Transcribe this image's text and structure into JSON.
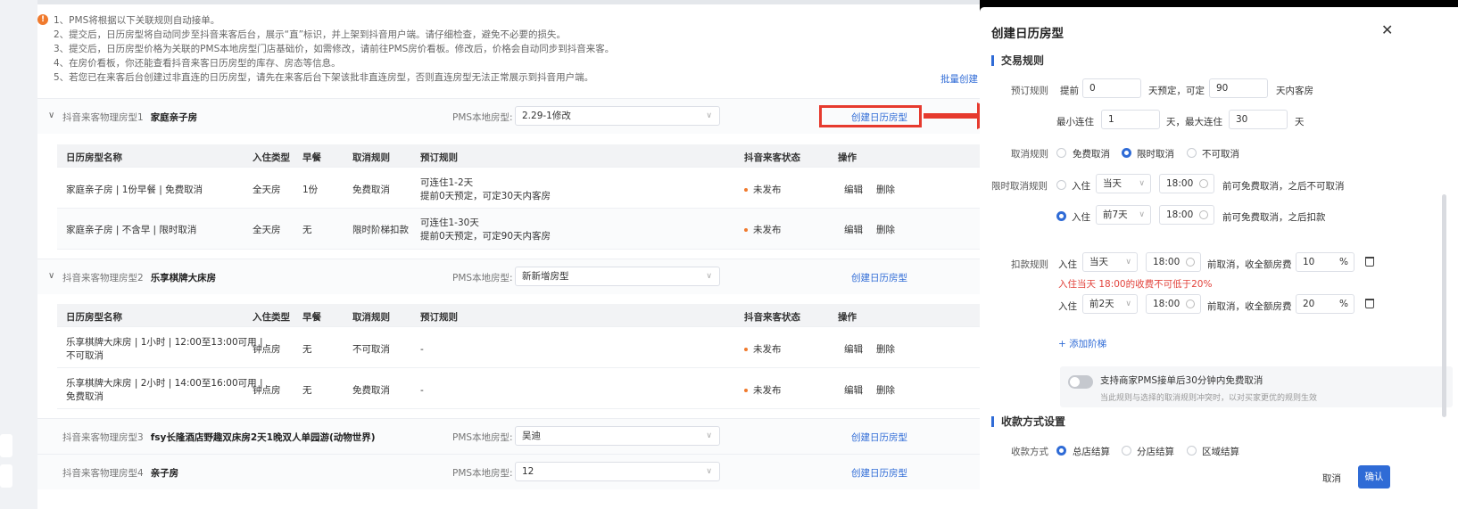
{
  "notices": [
    "1、PMS将根据以下关联规则自动接单。",
    "2、提交后，日历房型将自动同步至抖音来客后台，展示“直”标识，并上架到抖音用户端。请仔细检查，避免不必要的损失。",
    "3、提交后，日历房型价格为关联的PMS本地房型门店基础价，如需修改，请前往PMS房价看板。修改后，价格会自动同步到抖音来客。",
    "4、在房价看板，你还能查看抖音来客日历房型的库存、房态等信息。",
    "5、若您已在来客后台创建过非直连的日历房型，请先在来客后台下架该批非直连房型，否则直连房型无法正常展示到抖音用户端。"
  ],
  "batch_create": "批量创建",
  "pms_label": "PMS本地房型:",
  "create_label": "创建日历房型",
  "headers": [
    "日历房型名称",
    "入住类型",
    "早餐",
    "取消规则",
    "预订规则",
    "抖音来客状态",
    "操作"
  ],
  "edit_label": "编辑",
  "delete_label": "删除",
  "rooms": [
    {
      "label": "抖音来客物理房型1",
      "name": "家庭亲子房",
      "pms": "2.29-1修改",
      "rows": [
        {
          "name1": "家庭亲子房 | 1份早餐 | 免费取消",
          "name2": "",
          "type": "全天房",
          "breakfast": "1份",
          "cancel": "免费取消",
          "rule1": "可连住1-2天",
          "rule2": "提前0天预定，可定30天内客房",
          "status": "未发布"
        },
        {
          "name1": "家庭亲子房 | 不含早 | 限时取消",
          "name2": "",
          "type": "全天房",
          "breakfast": "无",
          "cancel": "限时阶梯扣款",
          "rule1": "可连住1-30天",
          "rule2": "提前0天预定，可定90天内客房",
          "status": "未发布"
        }
      ]
    },
    {
      "label": "抖音来客物理房型2",
      "name": "乐享棋牌大床房",
      "pms": "新新增房型",
      "rows": [
        {
          "name1": "乐享棋牌大床房 | 1小时 | 12:00至13:00可用 |",
          "name2": "不可取消",
          "type": "钟点房",
          "breakfast": "无",
          "cancel": "不可取消",
          "rule1": "-",
          "rule2": "",
          "status": "未发布"
        },
        {
          "name1": "乐享棋牌大床房 | 2小时 | 14:00至16:00可用 |",
          "name2": "免费取消",
          "type": "钟点房",
          "breakfast": "无",
          "cancel": "免费取消",
          "rule1": "-",
          "rule2": "",
          "status": "未发布"
        }
      ]
    },
    {
      "label": "抖音来客物理房型3",
      "name": "fsy长隆酒店野趣双床房2天1晚双人单园游(动物世界)",
      "pms": "吴迪"
    },
    {
      "label": "抖音来客物理房型4",
      "name": "亲子房",
      "pms": "12"
    }
  ],
  "modal": {
    "title": "创建日历房型",
    "section_trade": "交易规则",
    "booking_label": "预订规则",
    "advance_prefix": "提前",
    "advance_value": "0",
    "advance_mid": "天预定，可定",
    "advance_days": "90",
    "advance_suffix": "天内客房",
    "min_stay_prefix": "最小连住",
    "min_stay": "1",
    "max_stay_mid": "天，最大连住",
    "max_stay": "30",
    "day": "天",
    "cancel_label": "取消规则",
    "cancel_options": [
      "免费取消",
      "限时取消",
      "不可取消"
    ],
    "limited_label": "限时取消规则",
    "checkin": "入住",
    "limited_rows": [
      {
        "day": "当天",
        "time": "18:00",
        "text": "前可免费取消，之后不可取消"
      },
      {
        "day": "前7天",
        "time": "18:00",
        "text": "前可免费取消，之后扣款"
      }
    ],
    "deduct_label": "扣款规则",
    "deduct_rows": [
      {
        "day": "当天",
        "time": "18:00",
        "text": "前取消，收全额房费",
        "pct": "10"
      },
      {
        "day": "前2天",
        "time": "18:00",
        "text": "前取消，收全额房费",
        "pct": "20"
      }
    ],
    "percent": "%",
    "error_text": "入住当天 18:00的收费不可低于20%",
    "add_step": "添加阶梯",
    "toggle_text": "支持商家PMS接单后30分钟内免费取消",
    "toggle_hint": "当此规则与选择的取消规则冲突时，以对买家更优的规则生效",
    "section_payment": "收款方式设置",
    "payment_label": "收款方式",
    "payment_options": [
      "总店结算",
      "分店结算",
      "区域结算"
    ],
    "cancel_btn": "取消",
    "ok_btn": "确认"
  }
}
